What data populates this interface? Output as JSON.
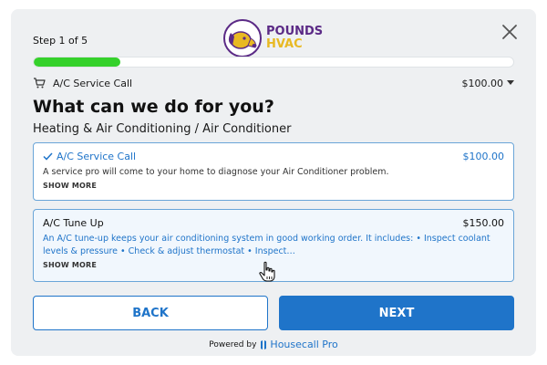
{
  "header": {
    "step_text": "Step 1 of 5",
    "logo": {
      "line1": "POUNDS",
      "line2": "HVAC",
      "icon": "dog-logo-icon"
    },
    "close_icon": "close-icon"
  },
  "progress": {
    "fraction": 0.18,
    "color": "#35d12b"
  },
  "cart": {
    "label": "A/C Service Call",
    "price": "$100.00",
    "icon": "cart-icon"
  },
  "title": "What can we do for you?",
  "breadcrumb": "Heating & Air Conditioning / Air Conditioner",
  "services": [
    {
      "title": "A/C Service Call",
      "price": "$100.00",
      "selected": true,
      "description": "A service pro will come to your home to diagnose your Air Conditioner problem.",
      "show_more": "SHOW MORE"
    },
    {
      "title": "A/C Tune Up",
      "price": "$150.00",
      "selected": false,
      "description": "An A/C tune-up keeps your air conditioning system in good working order. It includes: • Inspect coolant levels & pressure • Check & adjust thermostat • Inspect…",
      "show_more": "SHOW MORE"
    }
  ],
  "buttons": {
    "back": "BACK",
    "next": "NEXT"
  },
  "footer": {
    "powered_by": "Powered by",
    "brand": "Housecall Pro"
  },
  "colors": {
    "accent": "#1f74c9",
    "brand_purple": "#5b2a86",
    "brand_gold": "#e8b923"
  }
}
